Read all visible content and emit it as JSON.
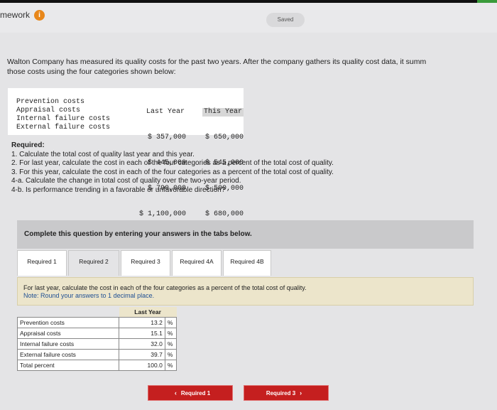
{
  "header": {
    "title": "mework",
    "info_icon": "info-icon",
    "saved": "Saved"
  },
  "intro": {
    "line1": "Walton Company has measured its quality costs for the past two years. After the company gathers its quality cost data, it summ",
    "line2": "those costs using the four categories shown below:"
  },
  "cost_table": {
    "headers": [
      "Last Year",
      "This Year"
    ],
    "rows": [
      {
        "label": "Prevention costs",
        "last": "$ 357,000",
        "this": "$ 650,000"
      },
      {
        "label": "Appraisal costs",
        "last": "$ 445,000",
        "this": "$ 545,000"
      },
      {
        "label": "Internal failure costs",
        "last": "$ 790,000",
        "this": "$ 500,000"
      },
      {
        "label": "External failure costs",
        "last": "$ 1,100,000",
        "this": "$ 680,000"
      }
    ]
  },
  "required": {
    "heading": "Required:",
    "items": [
      "1. Calculate the total cost of quality last year and this year.",
      "2. For last year, calculate the cost in each of the four categories as a percent of the total cost of quality.",
      "3. For this year, calculate the cost in each of the four categories as a percent of the total cost of quality.",
      "4-a. Calculate the change in total cost of quality over the two-year period.",
      "4-b. Is performance trending in a favorable or unfavorable direction?"
    ]
  },
  "complete_text": "Complete this question by entering your answers in the tabs below.",
  "tabs": [
    "Required 1",
    "Required 2",
    "Required 3",
    "Required 4A",
    "Required 4B"
  ],
  "panel": {
    "instruction": "For last year, calculate the cost in each of the four categories as a percent of the total cost of quality.",
    "note": "Note: Round your answers to 1 decimal place."
  },
  "answer_table": {
    "header": "Last Year",
    "rows": [
      {
        "label": "Prevention costs",
        "value": "13.2",
        "unit": "%"
      },
      {
        "label": "Appraisal costs",
        "value": "15.1",
        "unit": "%"
      },
      {
        "label": "Internal failure costs",
        "value": "32.0",
        "unit": "%"
      },
      {
        "label": "External failure costs",
        "value": "39.7",
        "unit": "%"
      },
      {
        "label": "Total percent",
        "value": "100.0",
        "unit": "%"
      }
    ]
  },
  "nav": {
    "prev": "Required 1",
    "next": "Required 3"
  }
}
